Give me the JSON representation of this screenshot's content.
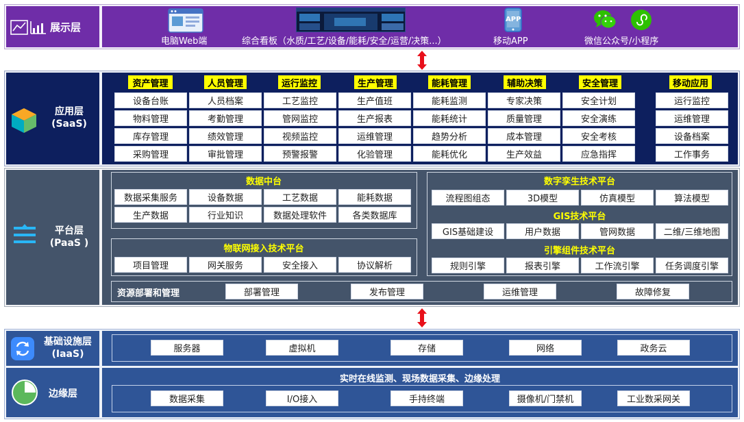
{
  "display_layer": {
    "label": "展示层",
    "items": [
      "电脑Web端",
      "综合看板（水质/工艺/设备/能耗/安全/运营/决策...）",
      "移动APP",
      "微信公众号/小程序"
    ],
    "app_icon_text": "APP"
  },
  "saas_layer": {
    "label1": "应用层",
    "label2": "(SaaS)",
    "columns": [
      {
        "header": "资产管理",
        "items": [
          "设备台账",
          "物料管理",
          "库存管理",
          "采购管理"
        ]
      },
      {
        "header": "人员管理",
        "items": [
          "人员档案",
          "考勤管理",
          "绩效管理",
          "审批管理"
        ]
      },
      {
        "header": "运行监控",
        "items": [
          "工艺监控",
          "管网监控",
          "视频监控",
          "预警报警"
        ]
      },
      {
        "header": "生产管理",
        "items": [
          "生产值班",
          "生产报表",
          "运维管理",
          "化验管理"
        ]
      },
      {
        "header": "能耗管理",
        "items": [
          "能耗监测",
          "能耗统计",
          "趋势分析",
          "能耗优化"
        ]
      },
      {
        "header": "辅助决策",
        "items": [
          "专家决策",
          "质量管理",
          "成本管理",
          "生产效益"
        ]
      },
      {
        "header": "安全管理",
        "items": [
          "安全计划",
          "安全演练",
          "安全考核",
          "应急指挥"
        ]
      },
      {
        "header": "移动应用",
        "items": [
          "运行监控",
          "运维管理",
          "设备档案",
          "工作事务"
        ]
      }
    ]
  },
  "paas_layer": {
    "label1": "平台层",
    "label2": "(PaaS )",
    "data_center": {
      "title": "数据中台",
      "items": [
        "数据采集服务",
        "设备数据",
        "工艺数据",
        "能耗数据",
        "生产数据",
        "行业知识",
        "数据处理软件",
        "各类数据库"
      ]
    },
    "iot": {
      "title": "物联网接入技术平台",
      "items": [
        "项目管理",
        "网关服务",
        "安全接入",
        "协议解析"
      ]
    },
    "digital_twin": {
      "title": "数字孪生技术平台",
      "items": [
        "流程图组态",
        "3D模型",
        "仿真模型",
        "算法模型"
      ]
    },
    "gis": {
      "title": "GIS技术平台",
      "items": [
        "GIS基础建设",
        "用户数据",
        "管网数据",
        "二维/三维地图"
      ]
    },
    "engine": {
      "title": "引擎组件技术平台",
      "items": [
        "规则引擎",
        "报表引擎",
        "工作流引擎",
        "任务调度引擎"
      ]
    },
    "resource": {
      "label": "资源部署和管理",
      "items": [
        "部署管理",
        "发布管理",
        "运维管理",
        "故障修复"
      ]
    }
  },
  "iaas_layer": {
    "label1": "基础设施层",
    "label2": "(IaaS)",
    "items": [
      "服务器",
      "虚拟机",
      "存储",
      "网络",
      "政务云"
    ]
  },
  "edge_layer": {
    "label": "边缘层",
    "title": "实时在线监测、现场数据采集、边缘处理",
    "items": [
      "数据采集",
      "I/O接入",
      "手持终端",
      "摄像机/门禁机",
      "工业数采网关"
    ]
  },
  "colors": {
    "display_purple": "#6f2da8",
    "saas_navy": "#0d1f5e",
    "paas_slate": "#44546a",
    "iaas_blue": "#2f5597",
    "highlight_yellow": "#ffff00",
    "arrow_red": "#e8101a"
  }
}
